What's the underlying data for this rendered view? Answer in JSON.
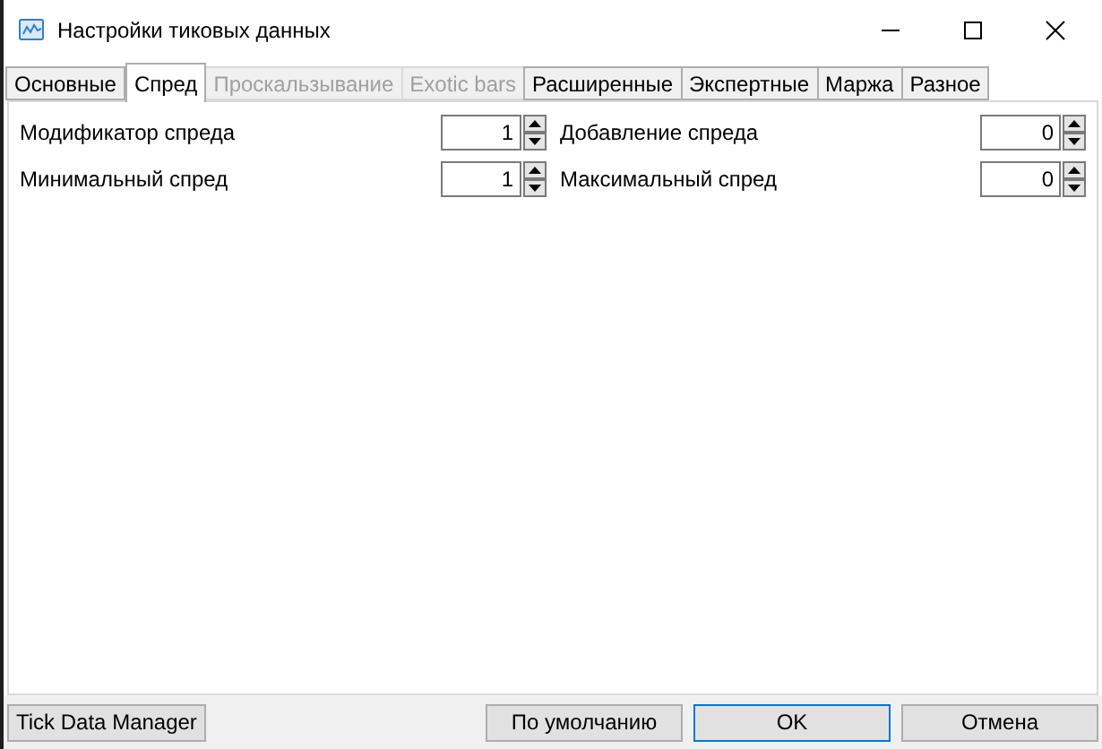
{
  "window": {
    "title": "Настройки тиковых данных"
  },
  "tabs": [
    {
      "label": "Основные",
      "selected": false,
      "disabled": false
    },
    {
      "label": "Спред",
      "selected": true,
      "disabled": false
    },
    {
      "label": "Проскальзывание",
      "selected": false,
      "disabled": true
    },
    {
      "label": "Exotic bars",
      "selected": false,
      "disabled": true
    },
    {
      "label": "Расширенные",
      "selected": false,
      "disabled": false
    },
    {
      "label": "Экспертные",
      "selected": false,
      "disabled": false
    },
    {
      "label": "Маржа",
      "selected": false,
      "disabled": false
    },
    {
      "label": "Разное",
      "selected": false,
      "disabled": false
    }
  ],
  "fields": [
    {
      "label": "Модификатор спреда",
      "value": "1"
    },
    {
      "label": "Добавление спреда",
      "value": "0"
    },
    {
      "label": "Минимальный спред",
      "value": "1"
    },
    {
      "label": "Максимальный спред",
      "value": "0"
    }
  ],
  "buttons": [
    {
      "label": "Tick Data Manager",
      "kind": "left"
    },
    {
      "label": "По умолчанию",
      "kind": "normal"
    },
    {
      "label": "OK",
      "kind": "default"
    },
    {
      "label": "Отмена",
      "kind": "normal"
    }
  ]
}
